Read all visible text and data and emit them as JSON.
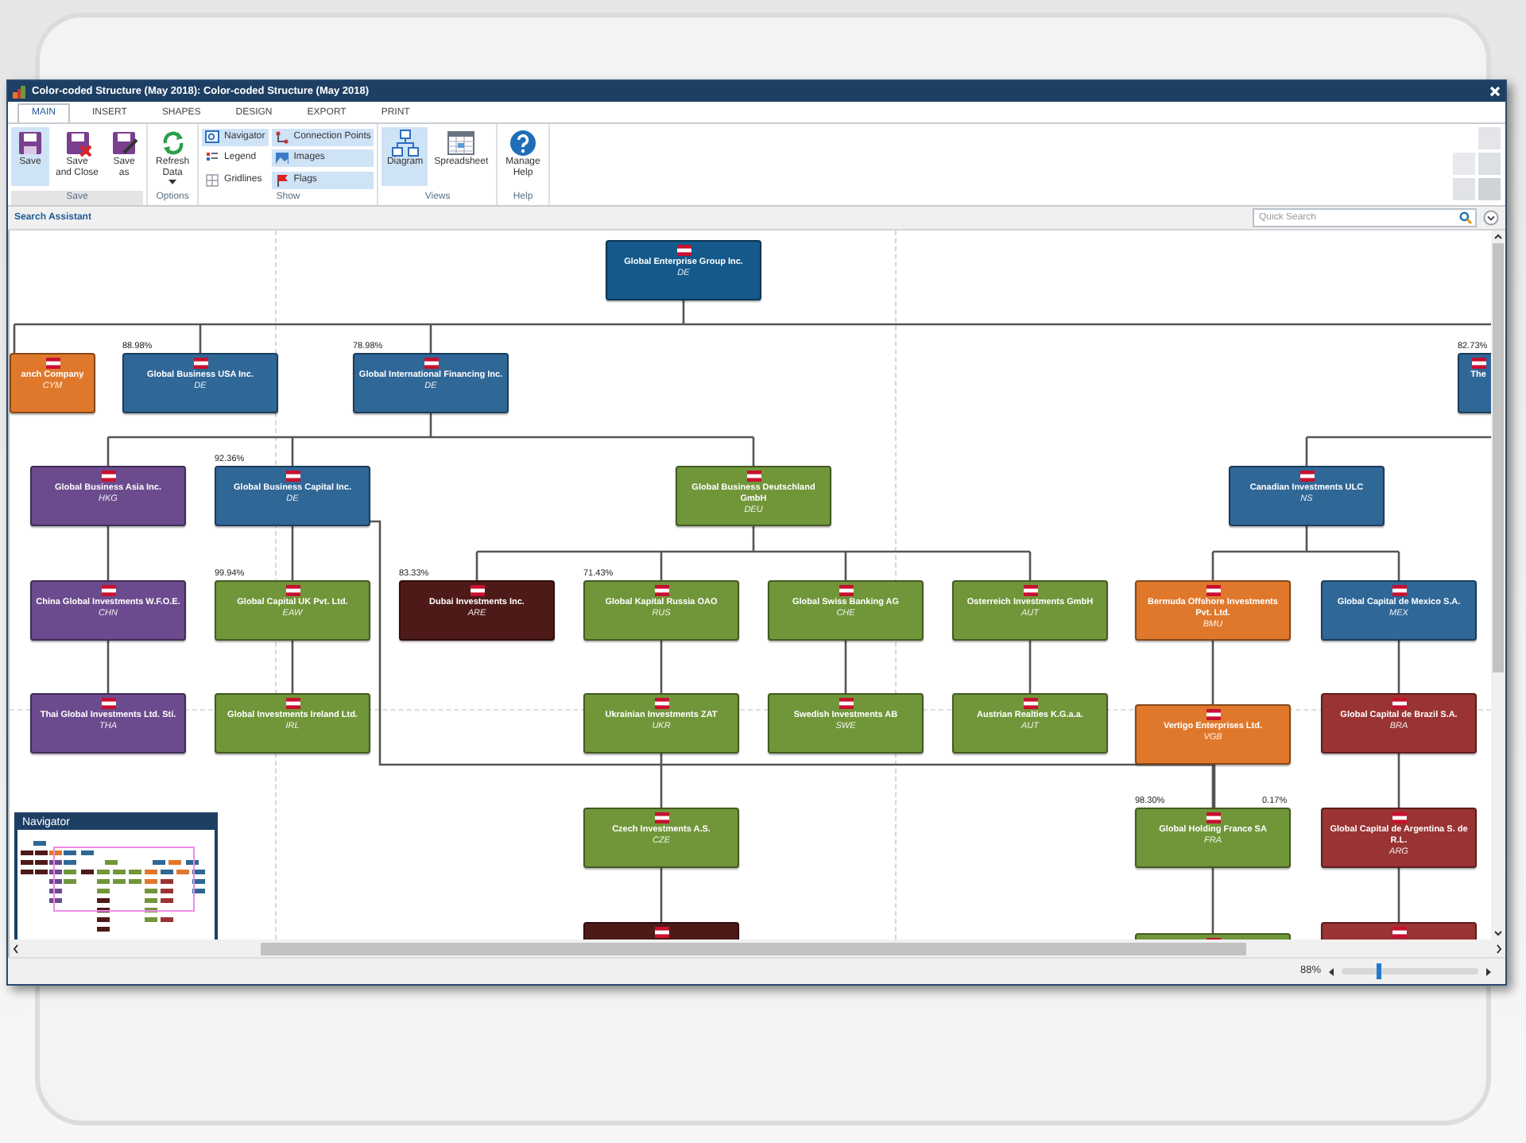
{
  "window": {
    "title": "Color-coded Structure (May 2018): Color-coded Structure (May 2018)"
  },
  "tabs": [
    {
      "label": "MAIN",
      "selected": true
    },
    {
      "label": "INSERT",
      "selected": false
    },
    {
      "label": "SHAPES",
      "selected": false
    },
    {
      "label": "DESIGN",
      "selected": false
    },
    {
      "label": "EXPORT",
      "selected": false
    },
    {
      "label": "PRINT",
      "selected": false
    }
  ],
  "ribbon": [
    {
      "label": "Save",
      "items": [
        {
          "kind": "large",
          "label": "Save",
          "selected": true
        },
        {
          "kind": "large",
          "label": "Save\nand Close",
          "selected": false
        },
        {
          "kind": "large",
          "label": "Save\nas",
          "selected": false
        }
      ]
    },
    {
      "label": "Options",
      "items": [
        {
          "kind": "dropdown",
          "label": "Refresh\nData",
          "selected": false
        }
      ]
    },
    {
      "label": "Show",
      "items": [
        {
          "kind": "small",
          "label": "Navigator",
          "selected": true
        },
        {
          "kind": "small",
          "label": "Legend",
          "selected": false
        },
        {
          "kind": "small",
          "label": "Gridlines",
          "selected": false
        },
        {
          "kind": "small",
          "label": "Connection Points",
          "selected": true
        },
        {
          "kind": "small",
          "label": "Images",
          "selected": true
        },
        {
          "kind": "small",
          "label": "Flags",
          "selected": true
        }
      ]
    },
    {
      "label": "Views",
      "items": [
        {
          "kind": "large",
          "label": "Diagram",
          "selected": true
        },
        {
          "kind": "large",
          "label": "Spreadsheet",
          "selected": false
        }
      ]
    },
    {
      "label": "Help",
      "items": [
        {
          "kind": "large",
          "label": "Manage\nHelp",
          "selected": false
        }
      ]
    }
  ],
  "search_assistant": {
    "label": "Search Assistant",
    "placeholder": "Quick Search"
  },
  "chart": {
    "root": {
      "name": "Global Enterprise Group Inc.",
      "code": "DE",
      "color": "#14598a",
      "children": [
        {
          "name": "anch Company",
          "code": "CYM",
          "color": "#e0782c"
        },
        {
          "name": "Global Business USA Inc.",
          "code": "DE",
          "color": "#2f6797",
          "shares": [
            "88.98%"
          ]
        },
        {
          "name": "Global International Financing Inc.",
          "code": "DE",
          "color": "#2f6797",
          "shares": [
            "78.98%"
          ],
          "children": [
            {
              "name": "Global Business Asia Inc.",
              "code": "HKG",
              "color": "#6b4b8e",
              "children": [
                {
                  "name": "China Global Investments W.F.O.E.",
                  "code": "CHN",
                  "color": "#6b4b8e",
                  "children": [
                    {
                      "name": "Thai Global Investments Ltd. Sti.",
                      "code": "THA",
                      "color": "#6b4b8e"
                    }
                  ]
                }
              ]
            },
            {
              "name": "Global Business Capital Inc.",
              "code": "DE",
              "color": "#2f6797",
              "shares": [
                "92.36%"
              ],
              "children": [
                {
                  "name": "Global Capital UK Pvt. Ltd.",
                  "code": "EAW",
                  "color": "#71963a",
                  "shares": [
                    "99.94%"
                  ],
                  "children": [
                    {
                      "name": "Global Investments Ireland Ltd.",
                      "code": "IRL",
                      "color": "#71963a"
                    }
                  ]
                }
              ]
            },
            {
              "name": "Global Business Deutschland GmbH",
              "code": "DEU",
              "color": "#71963a",
              "children": [
                {
                  "name": "Dubai Investments Inc.",
                  "code": "ARE",
                  "color": "#4e1a18",
                  "shares": [
                    "83.33%"
                  ]
                },
                {
                  "name": "Global Kapital Russia OAO",
                  "code": "RUS",
                  "color": "#71963a",
                  "shares": [
                    "71.43%"
                  ],
                  "children": [
                    {
                      "name": "Ukrainian Investments ZAT",
                      "code": "UKR",
                      "color": "#71963a",
                      "children": [
                        {
                          "name": "Czech Investments A.S.",
                          "code": "CZE",
                          "color": "#71963a",
                          "children": [
                            {
                              "color": "#4e1a18"
                            }
                          ]
                        }
                      ]
                    }
                  ]
                },
                {
                  "name": "Global Swiss Banking AG",
                  "code": "CHE",
                  "color": "#71963a",
                  "children": [
                    {
                      "name": "Swedish Investments AB",
                      "code": "SWE",
                      "color": "#71963a"
                    }
                  ]
                },
                {
                  "name": "Osterreich Investments GmbH",
                  "code": "AUT",
                  "color": "#71963a",
                  "children": [
                    {
                      "name": "Austrian Realties K.G.a.a.",
                      "code": "AUT",
                      "color": "#71963a"
                    }
                  ]
                }
              ]
            }
          ]
        },
        {
          "name": "The",
          "color": "#2f6797",
          "shares": [
            "82.73%"
          ],
          "children": [
            {
              "name": "Canadian Investments ULC",
              "code": "NS",
              "color": "#2f6797",
              "children": [
                {
                  "name": "Bermuda Offshore Investments Pvt. Ltd.",
                  "code": "BMU",
                  "color": "#e0782c",
                  "children": [
                    {
                      "name": "Vertigo Enterprises Ltd.",
                      "code": "VGB",
                      "color": "#e0782c",
                      "children": [
                        {
                          "name": "Global Holding France SA",
                          "code": "FRA",
                          "color": "#71963a",
                          "shares": [
                            "98.30%",
                            "0.17%"
                          ],
                          "children": [
                            {
                              "color": "#71963a"
                            }
                          ]
                        }
                      ]
                    }
                  ]
                },
                {
                  "name": "Global Capital de Mexico S.A.",
                  "code": "MEX",
                  "color": "#2f6797",
                  "children": [
                    {
                      "name": "Global Capital de Brazil S.A.",
                      "code": "BRA",
                      "color": "#9a3333",
                      "children": [
                        {
                          "name": "Global Capital de Argentina S. de R.L.",
                          "code": "ARG",
                          "color": "#9a3333",
                          "children": [
                            {
                              "color": "#9a3333"
                            }
                          ]
                        }
                      ]
                    }
                  ]
                }
              ]
            }
          ]
        }
      ]
    }
  },
  "navigator": {
    "title": "Navigator"
  },
  "zoom": {
    "value": "88%",
    "level": 0.25
  }
}
